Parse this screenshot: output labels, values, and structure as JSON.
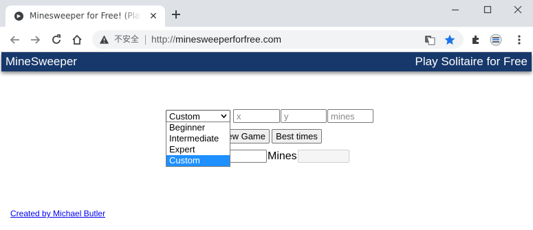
{
  "browser": {
    "tab": {
      "title": "Minesweeper for Free! (Play In",
      "close_glyph": "✕"
    },
    "omnibox": {
      "security_label": "不安全",
      "url_scheme": "http://",
      "url_host": "minesweeperforfree.com"
    },
    "icons": [
      "back-icon",
      "forward-icon",
      "reload-icon",
      "home-icon",
      "warning-icon",
      "translate-icon",
      "star-icon",
      "extensions-icon",
      "profile-icon",
      "menu-icon",
      "new-tab-icon",
      "minimize-icon",
      "maximize-icon",
      "close-window-icon"
    ],
    "accent_color": "#1a73e8"
  },
  "page": {
    "header": {
      "brand": "MineSweeper",
      "promo_link": "Play Solitaire for Free",
      "background": "#17386b"
    },
    "difficulty": {
      "selected": "Custom",
      "options": [
        "Beginner",
        "Intermediate",
        "Expert",
        "Custom"
      ],
      "highlighted_option": "Custom"
    },
    "custom_inputs": {
      "x_placeholder": "x",
      "y_placeholder": "y",
      "mines_placeholder": "mines"
    },
    "buttons": {
      "new_game_visible": "ew Game",
      "best_times": "Best times"
    },
    "status": {
      "mines_label": "Mines:"
    },
    "footer": {
      "credit": "Created by Michael Butler"
    }
  }
}
